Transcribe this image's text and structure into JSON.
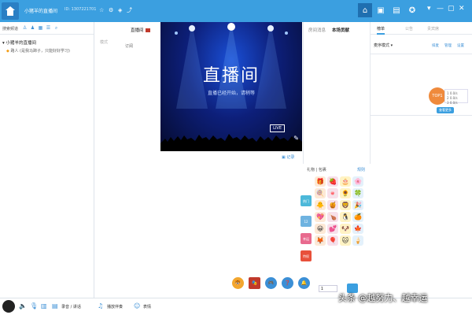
{
  "titlebar": {
    "title": "小猪羊的直播间",
    "subtitle": "ID: 1307221701",
    "icons": [
      "home-icon",
      "star-icon",
      "settings-icon",
      "share-icon"
    ],
    "right_icons": [
      "home-icon",
      "contacts-icon",
      "message-icon",
      "game-icon"
    ],
    "window_controls": [
      "menu-icon",
      "minimize-icon",
      "maximize-icon",
      "close-icon"
    ]
  },
  "leftpanel": {
    "toolbar_label": "搜索频道",
    "channel_name": "小猪羊的直播间",
    "user_entry": "路人  (是我马蹄子，只能好好学习)"
  },
  "center": {
    "header": "直播间",
    "follow_label": "订阅",
    "side_hint": "模式",
    "record_label": "记录"
  },
  "video": {
    "title": "直播间",
    "subtitle": "直播已经开始，请稍等",
    "logo": "LIVE"
  },
  "chat": {
    "tabs": [
      "房间消息",
      "本场贡献"
    ]
  },
  "rightpanel": {
    "tabs": [
      "榜单",
      "公告",
      "贵宾席"
    ],
    "mode_label": "麦序模式 ▾",
    "links": [
      "排麦",
      "管理",
      "设置"
    ],
    "score_value": "TOP1",
    "score_lines": [
      "1  0.0/s",
      "2  0.0/s",
      "3  0.0/s"
    ],
    "score_tag": "查看更多"
  },
  "gift": {
    "tabs": "礼物 | 包裹",
    "help": "规则",
    "side_tabs": [
      "热门",
      "12",
      "幸运",
      "特权"
    ],
    "items": [
      "🎁",
      "🍓",
      "🎂",
      "🌸",
      "🍭",
      "🍬",
      "🌻",
      "🍀",
      "🐥",
      "🍯",
      "🦁",
      "🎉",
      "💖",
      "🍗",
      "🐧",
      "🍊",
      "😀",
      "💕",
      "🐶",
      "🍁",
      "🦊",
      "🎈",
      "🐱",
      "🍦"
    ],
    "quantity": "1"
  },
  "bottombar": {
    "labels": [
      "录音 / 讲话",
      "播放伴奏",
      "表情"
    ],
    "favs": [
      "🐯",
      "🎭",
      "🎮",
      "❓",
      "🔔"
    ]
  },
  "watermark": "头条 @越努力、越幸运",
  "colors": {
    "accent": "#3b9fe0",
    "score": "#ef8a3c",
    "gift_side": [
      "#4cb8d9",
      "#6fb3e0",
      "#e86a8e",
      "#e8503a"
    ]
  }
}
